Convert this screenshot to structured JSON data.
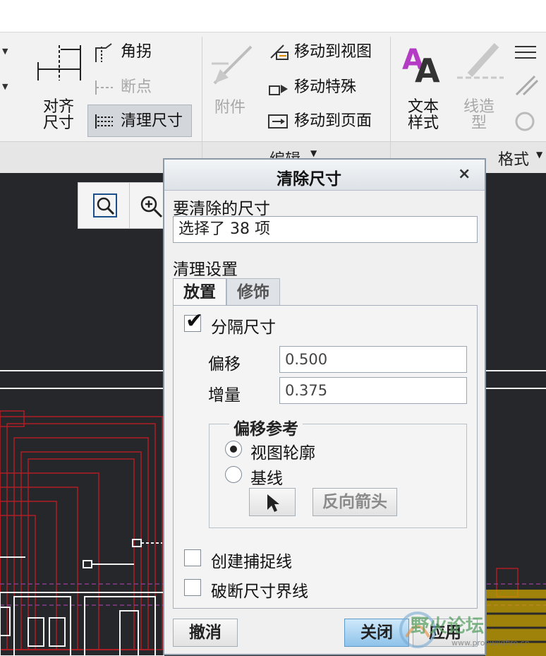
{
  "ribbon": {
    "align_dim": "对齐尺寸",
    "align_dim_line1": "对齐",
    "align_dim_line2": "尺寸",
    "corner": "角拐",
    "breakpoint": "断点",
    "clean_dim": "清理尺寸",
    "attach": "附件",
    "move_to_view": "移动到视图",
    "move_special": "移动特殊",
    "move_to_page": "移动到页面",
    "text_style_line1": "文本",
    "text_style_line2": "样式",
    "line_type_line1": "线造",
    "line_type_line2": "型",
    "edit_group": "编辑",
    "format_group": "格式"
  },
  "dialog": {
    "title": "清除尺寸",
    "close_symbol": "×",
    "dims_to_clean_label": "要清除的尺寸",
    "selection_text": "选择了 38 项",
    "settings_label": "清理设置",
    "tabs": [
      "放置",
      "修饰"
    ],
    "separate_dims": "分隔尺寸",
    "separate_dims_checked": true,
    "offset_label": "偏移",
    "offset_value": "0.500",
    "increment_label": "增量",
    "increment_value": "0.375",
    "offset_ref_title": "偏移参考",
    "radio_view_outline": "视图轮廓",
    "radio_baseline": "基线",
    "reverse_arrow": "反向箭头",
    "create_snap_lines": "创建捕捉线",
    "break_witness_lines": "破断尺寸界线",
    "cancel": "撤消",
    "close": "关闭",
    "apply": "应用"
  },
  "watermark": {
    "brand": "野火论坛",
    "url": "www.proewildfire.cn"
  },
  "colors": {
    "drawing_bg": "#25272b",
    "dim_red": "#b01e24",
    "primary_btn": "#8ec3ea"
  }
}
